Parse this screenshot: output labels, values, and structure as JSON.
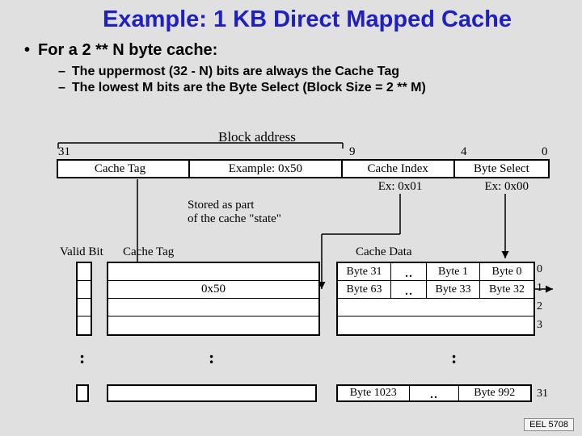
{
  "title": "Example: 1 KB Direct Mapped Cache",
  "bullets": {
    "main": "For a 2 ** N byte cache:",
    "sub1": "The uppermost (32 - N) bits are always the Cache Tag",
    "sub2": "The lowest M bits are the Byte Select (Block Size = 2 ** M)"
  },
  "addr": {
    "block_label": "Block address",
    "ticks": {
      "t31": "31",
      "t9": "9",
      "t4": "4",
      "t0": "0"
    },
    "tag": "Cache Tag",
    "example": "Example: 0x50",
    "ci": "Cache Index",
    "bs": "Byte Select",
    "ex_ci": "Ex: 0x01",
    "ex_bs": "Ex: 0x00"
  },
  "stored": {
    "l1": "Stored as part",
    "l2": "of the cache \"state\""
  },
  "labels": {
    "valid_bit": "Valid Bit",
    "cache_tag": "Cache Tag",
    "cache_data": "Cache Data"
  },
  "ctag_val": "0x50",
  "data_rows": {
    "r0": {
      "a": "Byte 31",
      "c": "Byte 1",
      "d": "Byte 0"
    },
    "r1": {
      "a": "Byte 63",
      "c": "Byte 33",
      "d": "Byte 32"
    },
    "last": {
      "a": "Byte 1023",
      "d": "Byte 992"
    }
  },
  "dots": "..",
  "row_nums": {
    "r0": "0",
    "r1": "1",
    "r2": "2",
    "r3": "3",
    "r31": "31"
  },
  "footer": "EEL 5708"
}
